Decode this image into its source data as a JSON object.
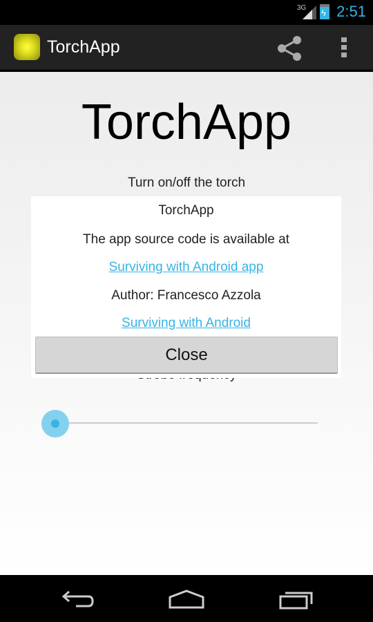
{
  "status_bar": {
    "network": "3G",
    "time": "2:51"
  },
  "action_bar": {
    "title": "TorchApp"
  },
  "main": {
    "title": "TorchApp",
    "subtitle": "Turn on/off the torch",
    "strobe_label": "Strobe frequency",
    "slider_value": 0
  },
  "dialog": {
    "title": "TorchApp",
    "line1": "The app source code is available at",
    "link1": "Surviving with Android app ",
    "author": "Author: Francesco Azzola",
    "link2": "Surviving with Android ",
    "close_label": "Close"
  },
  "colors": {
    "accent": "#33b5e5"
  }
}
